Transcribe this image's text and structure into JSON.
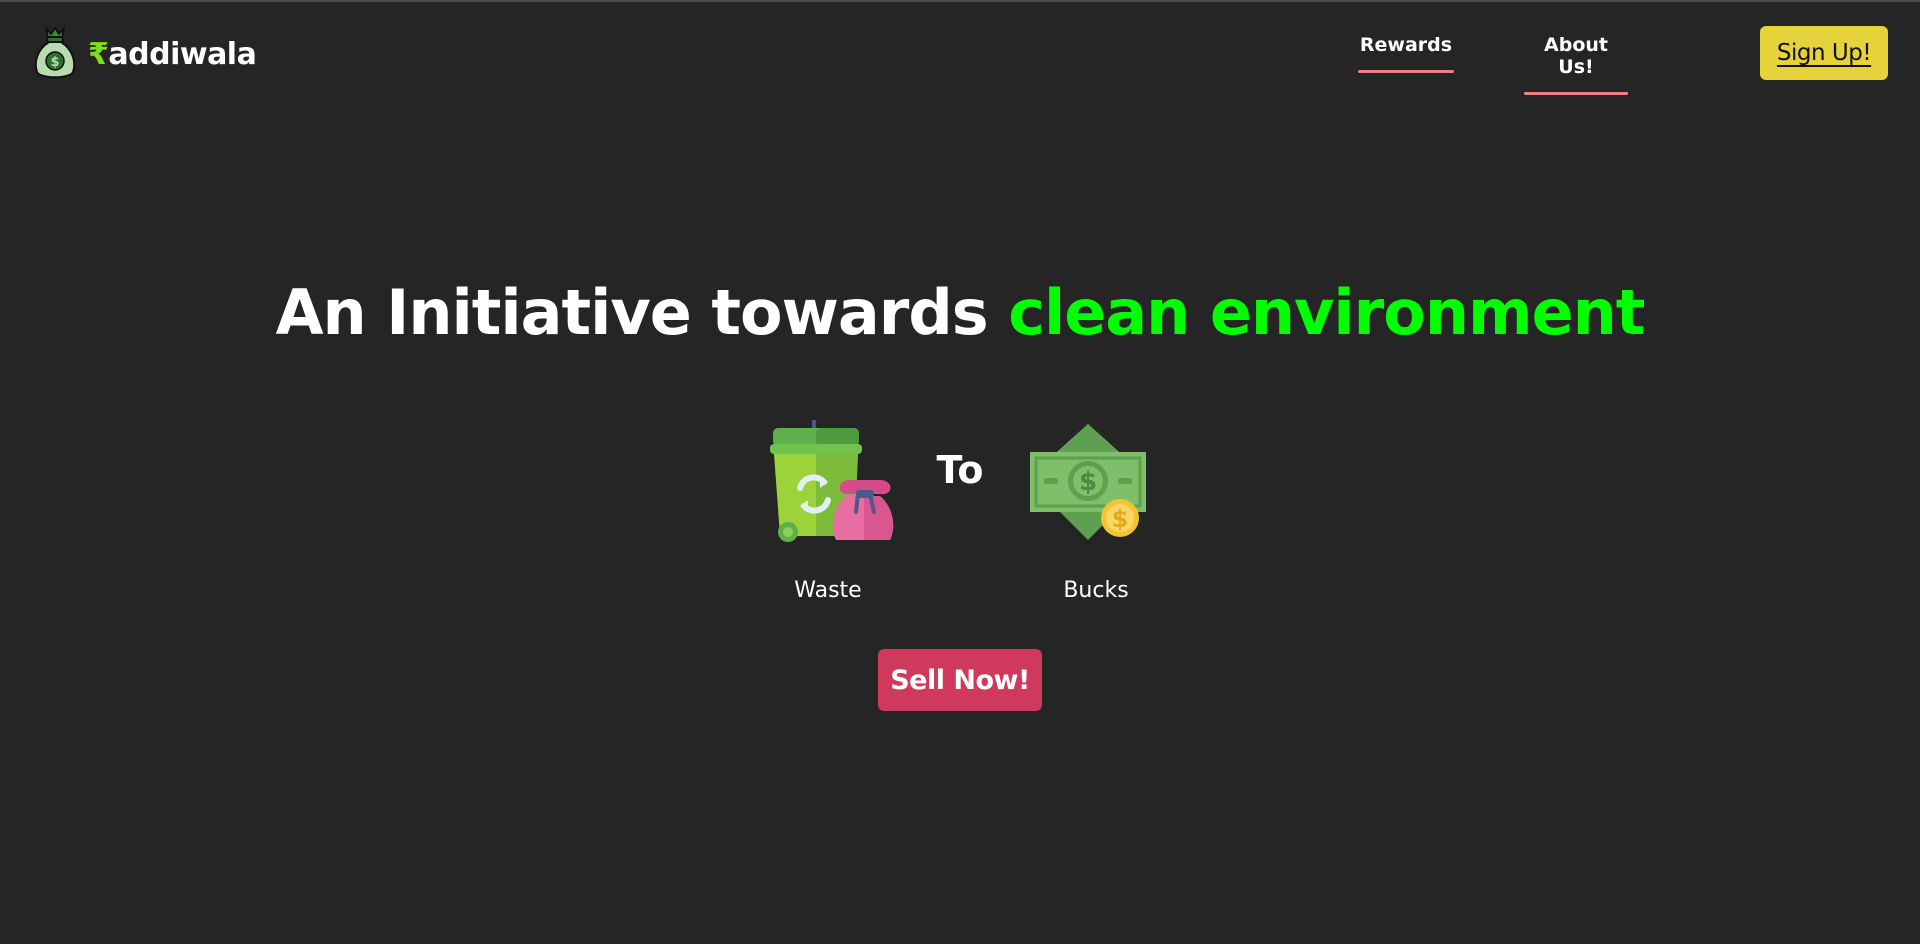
{
  "navbar": {
    "logo": {
      "icon": "money-bag-icon",
      "rupee_glyph": "₹",
      "name_rest": "addiwala",
      "rupee_color": "#7ee01a"
    },
    "links": [
      {
        "label": "Rewards"
      },
      {
        "label": "About Us!"
      }
    ],
    "link_underline_color": "#f08080",
    "signup_label": "Sign Up!",
    "signup_color": "#e6d23a"
  },
  "hero": {
    "headline_part1": "An Initiative towards ",
    "headline_part2": "clean environment",
    "headline_accent_color": "#00ff00",
    "from_icon": "recycle-bin-with-bag-icon",
    "from_label": "Waste",
    "connector": "To",
    "to_icon": "dollar-banknote-coin-icon",
    "to_label": "Bucks",
    "cta_label": "Sell Now!",
    "cta_color": "#cf3a5c"
  },
  "page": {
    "background_color": "#252525"
  }
}
